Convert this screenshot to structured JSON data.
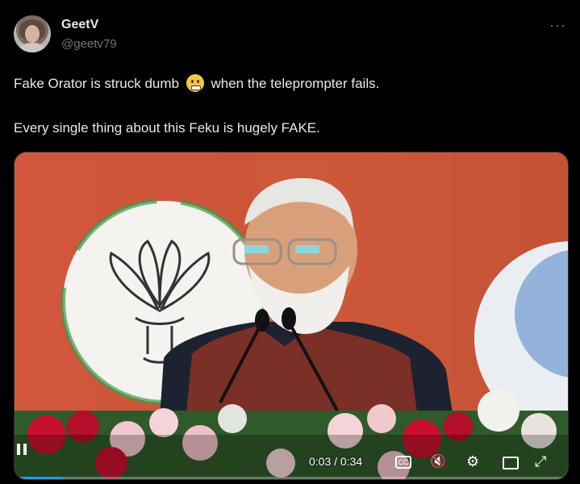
{
  "author": {
    "name": "GeetV",
    "handle": "@geetv79"
  },
  "more_label": "···",
  "post": {
    "line1_before": "Fake Orator is struck dumb",
    "line1_after": "when the teleprompter fails.",
    "line2": "Every single thing about this Feku is hugely FAKE.",
    "emoji": "zipper-mouth-face"
  },
  "video": {
    "time": "0:03 / 0:34",
    "progress": 0.088,
    "cc_label": "CC"
  },
  "colors": {
    "background": "#000000",
    "text": "#e7e9ea",
    "muted": "#71767b",
    "accent": "#1d9bf0"
  }
}
